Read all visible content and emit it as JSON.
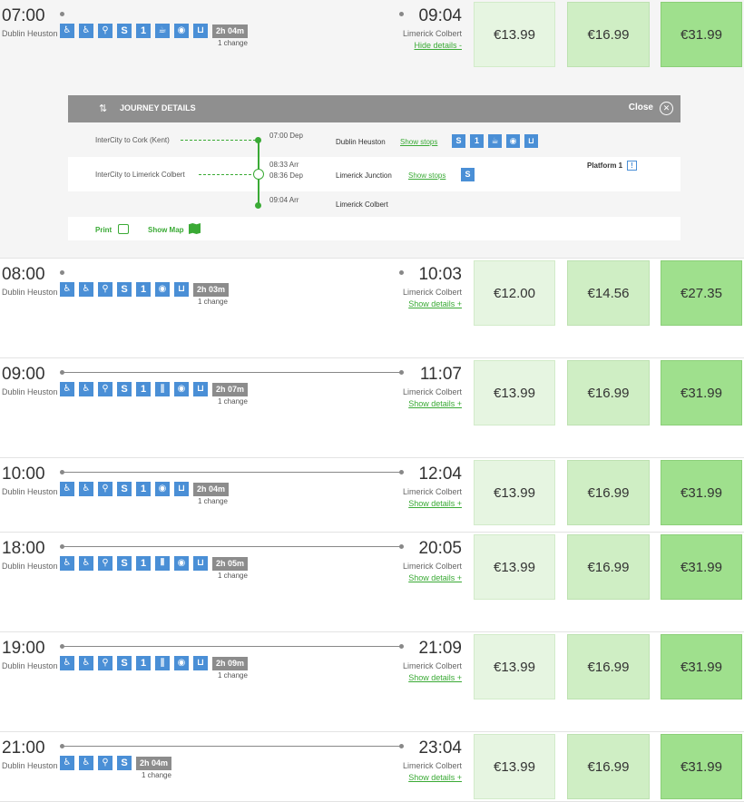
{
  "journeys": [
    {
      "dep": "07:00",
      "arr": "09:04",
      "from": "Dublin Heuston",
      "to": "Limerick Colbert",
      "duration": "2h 04m",
      "changes": "1 change",
      "link": "Hide details -",
      "fares": [
        "€13.99",
        "€16.99",
        "€31.99"
      ],
      "icons": [
        "wheelchair-icon",
        "accessible-icon",
        "bike-icon",
        "S",
        "1",
        "coffee-icon",
        "restaurant-icon",
        "trolley-icon"
      ]
    },
    {
      "dep": "08:00",
      "arr": "10:03",
      "from": "Dublin Heuston",
      "to": "Limerick Colbert",
      "duration": "2h 03m",
      "changes": "1 change",
      "link": "Show details +",
      "fares": [
        "€12.00",
        "€14.56",
        "€27.35"
      ],
      "icons": [
        "wheelchair-icon",
        "accessible-icon",
        "bike-icon",
        "S",
        "1",
        "restaurant-icon",
        "trolley-icon"
      ]
    },
    {
      "dep": "09:00",
      "arr": "11:07",
      "from": "Dublin Heuston",
      "to": "Limerick Colbert",
      "duration": "2h 07m",
      "changes": "1 change",
      "link": "Show details +",
      "fares": [
        "€13.99",
        "€16.99",
        "€31.99"
      ],
      "icons": [
        "wheelchair-icon",
        "accessible-icon",
        "bike-icon",
        "S",
        "1",
        "cutlery-icon",
        "restaurant-icon",
        "trolley-icon"
      ]
    },
    {
      "dep": "10:00",
      "arr": "12:04",
      "from": "Dublin Heuston",
      "to": "Limerick Colbert",
      "duration": "2h 04m",
      "changes": "1 change",
      "link": "Show details +",
      "fares": [
        "€13.99",
        "€16.99",
        "€31.99"
      ],
      "icons": [
        "wheelchair-icon",
        "accessible-icon",
        "bike-icon",
        "S",
        "1",
        "restaurant-icon",
        "trolley-icon"
      ]
    },
    {
      "dep": "18:00",
      "arr": "20:05",
      "from": "Dublin Heuston",
      "to": "Limerick Colbert",
      "duration": "2h 05m",
      "changes": "1 change",
      "link": "Show details +",
      "fares": [
        "€13.99",
        "€16.99",
        "€31.99"
      ],
      "icons": [
        "wheelchair-icon",
        "accessible-icon",
        "bike-icon",
        "S",
        "1",
        "dining-icon",
        "restaurant-icon",
        "trolley-icon"
      ]
    },
    {
      "dep": "19:00",
      "arr": "21:09",
      "from": "Dublin Heuston",
      "to": "Limerick Colbert",
      "duration": "2h 09m",
      "changes": "1 change",
      "link": "Show details +",
      "fares": [
        "€13.99",
        "€16.99",
        "€31.99"
      ],
      "icons": [
        "wheelchair-icon",
        "accessible-icon",
        "bike-icon",
        "S",
        "1",
        "cutlery-icon",
        "restaurant-icon",
        "trolley-icon"
      ]
    },
    {
      "dep": "21:00",
      "arr": "23:04",
      "from": "Dublin Heuston",
      "to": "Limerick Colbert",
      "duration": "2h 04m",
      "changes": "1 change",
      "link": "Show details +",
      "fares": [
        "€13.99",
        "€16.99",
        "€31.99"
      ],
      "icons": [
        "wheelchair-icon",
        "accessible-icon",
        "bike-icon",
        "S"
      ]
    }
  ],
  "details": {
    "title": "JOURNEY DETAILS",
    "close": "Close",
    "leg1_service": "InterCity to Cork (Kent)",
    "leg2_service": "InterCity to Limerick Colbert",
    "t1": "07:00 Dep",
    "t2a": "08:33 Arr",
    "t2b": "08:36 Dep",
    "t3": "09:04 Arr",
    "s1": "Dublin Heuston",
    "s2": "Limerick Junction",
    "s3": "Limerick Colbert",
    "show_stops": "Show stops",
    "platform": "Platform 1",
    "print": "Print",
    "show_map": "Show Map"
  },
  "colors": {
    "accent": "#3aaa35",
    "icon_blue": "#4a8fd6",
    "fare_light": "#e6f5e1",
    "fare_mid": "#cfeec4",
    "fare_dark": "#9fe08d"
  }
}
